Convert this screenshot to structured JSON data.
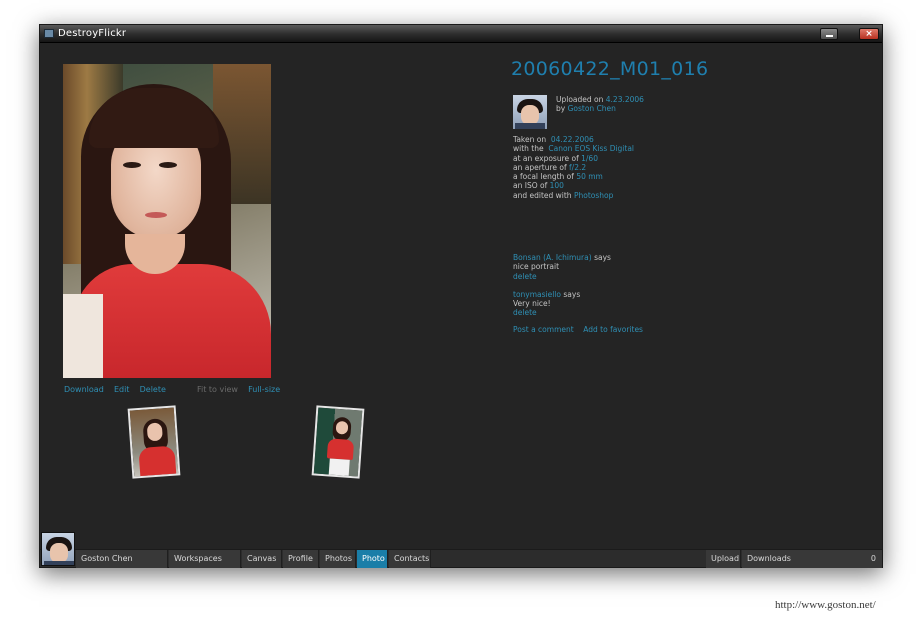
{
  "window": {
    "title": "DestroyFlickr",
    "close_glyph": "×"
  },
  "photo_view": {
    "actions": {
      "download": "Download",
      "edit": "Edit",
      "delete": "Delete",
      "fit_to_view": "Fit to view",
      "full_size": "Full-size"
    }
  },
  "details": {
    "title": "20060422_M01_016",
    "uploaded_on_label": "Uploaded on",
    "uploaded_on": "4.23.2006",
    "by_label": "by",
    "uploader": "Goston Chen",
    "taken_on_label": "Taken on",
    "taken_on": "04.22.2006",
    "camera_label": "with the",
    "camera": "Canon EOS Kiss Digital",
    "exposure_label": "at an exposure of",
    "exposure": "1/60",
    "aperture_label": "an aperture of",
    "aperture": "f/2.2",
    "focal_label": "a focal length of",
    "focal_length": "50 mm",
    "iso_label": "an ISO of",
    "iso": "100",
    "software_label": "and edited with",
    "software": "Photoshop"
  },
  "comments": [
    {
      "author": "Bonsan (A. Ichimura)",
      "says": "says",
      "text": "nice portrait",
      "delete": "delete"
    },
    {
      "author": "tonymasiello",
      "says": "says",
      "text": "Very nice!",
      "delete": "delete"
    }
  ],
  "comment_actions": {
    "post": "Post a comment",
    "favorite": "Add to favorites"
  },
  "bottom_bar": {
    "user": "Goston Chen",
    "nav": [
      "Workspaces",
      "Canvas",
      "Profile",
      "Photos",
      "Photo",
      "Contacts"
    ],
    "active_nav": "Photo",
    "upload": "Upload",
    "downloads": "Downloads",
    "downloads_count": "0"
  },
  "watermark": "http://www.goston.net/",
  "colors": {
    "accent": "#1a7ea8",
    "link": "#2f8fb4",
    "background": "#242424",
    "title_link": "#1f7fae"
  }
}
